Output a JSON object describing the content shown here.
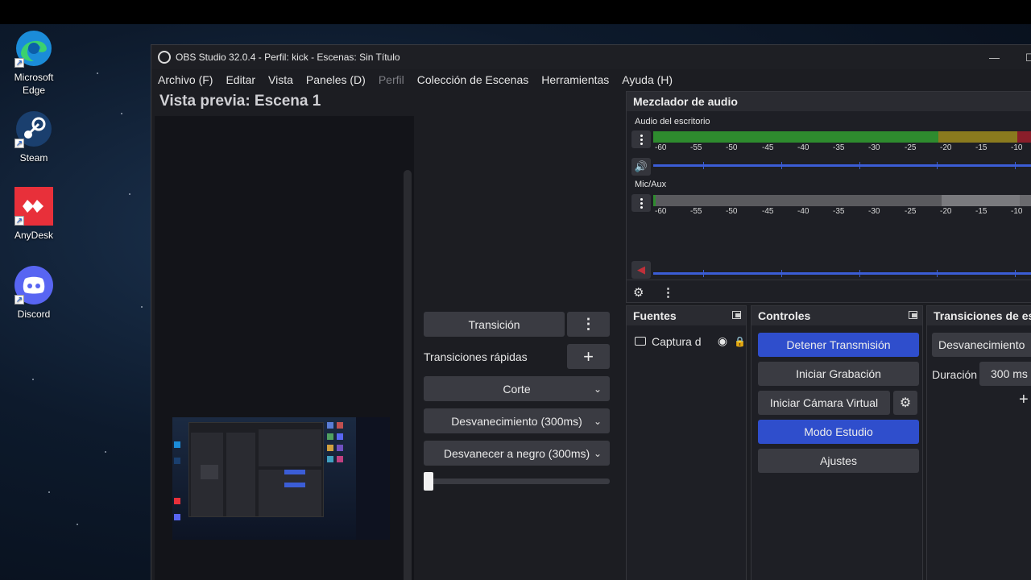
{
  "desktop": {
    "icons": [
      {
        "label": "Microsoft Edge",
        "icon": "edge-icon"
      },
      {
        "label": "Steam",
        "icon": "steam-icon"
      },
      {
        "label": "AnyDesk",
        "icon": "anydesk-icon"
      },
      {
        "label": "Discord",
        "icon": "discord-icon"
      }
    ]
  },
  "window": {
    "title": "OBS Studio 32.0.4 - Perfil: kick - Escenas: Sin Título",
    "menu": [
      "Archivo (F)",
      "Editar",
      "Vista",
      "Paneles (D)",
      "Perfil",
      "Colección de Escenas",
      "Herramientas",
      "Ayuda (H)"
    ],
    "disabled_menu": "Perfil"
  },
  "preview": {
    "title": "Vista previa: Escena 1"
  },
  "transitions_column": {
    "transition_button": "Transición",
    "quick_label": "Transiciones rápidas",
    "items": [
      "Corte",
      "Desvanecimiento (300ms)",
      "Desvanecer a negro (300ms)"
    ],
    "tbar_value": 0
  },
  "mixer": {
    "title": "Mezclador de audio",
    "scale": [
      "-60",
      "-55",
      "-50",
      "-45",
      "-40",
      "-35",
      "-30",
      "-25",
      "-20",
      "-15",
      "-10"
    ],
    "channels": [
      {
        "name": "Audio del escritorio",
        "muted": false,
        "active": true
      },
      {
        "name": "Mic/Aux",
        "muted": true,
        "active": false
      }
    ],
    "colors": {
      "green": "#2e8b2e",
      "yellow": "#8a7a1e",
      "red": "#8a1e2a",
      "grey": "#5a5a5e",
      "accent": "#3b5dd6"
    }
  },
  "sources": {
    "title": "Fuentes",
    "items": [
      {
        "name": "Captura d"
      }
    ]
  },
  "controls": {
    "title": "Controles",
    "stop_stream": "Detener Transmisión",
    "start_recording": "Iniciar Grabación",
    "start_virtual_cam": "Iniciar Cámara Virtual",
    "studio_mode": "Modo Estudio",
    "settings": "Ajustes"
  },
  "scene_transitions": {
    "title": "Transiciones de esc",
    "selected": "Desvanecimiento",
    "duration_label": "Duración",
    "duration_value": "300 ms"
  }
}
